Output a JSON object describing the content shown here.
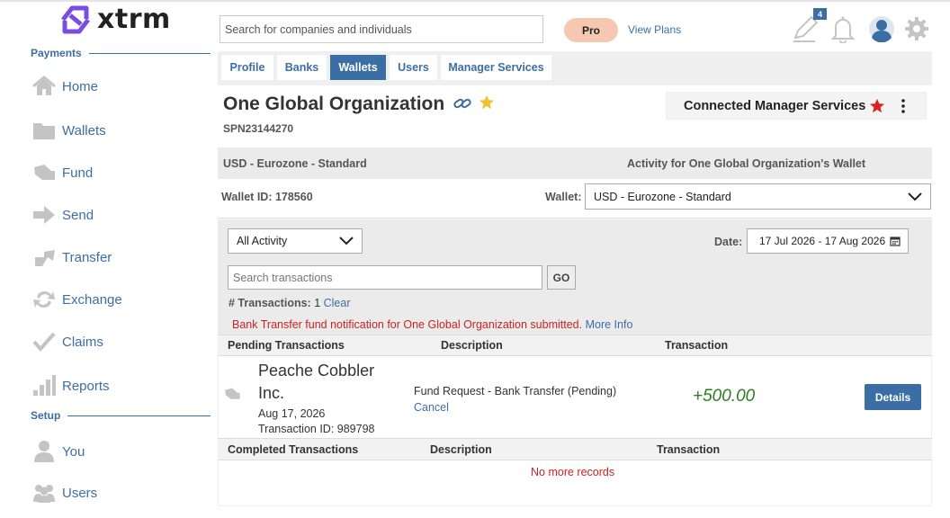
{
  "brand": {
    "name": "xtrm",
    "color": "#7b4ce0"
  },
  "sidebar": {
    "payments_label": "Payments",
    "setup_label": "Setup",
    "items": [
      {
        "label": "Home",
        "icon": "home-icon"
      },
      {
        "label": "Wallets",
        "icon": "folder-icon"
      },
      {
        "label": "Fund",
        "icon": "fund-icon"
      },
      {
        "label": "Send",
        "icon": "arrow-right-icon"
      },
      {
        "label": "Transfer",
        "icon": "transfer-icon"
      },
      {
        "label": "Exchange",
        "icon": "exchange-icon"
      },
      {
        "label": "Claims",
        "icon": "check-icon"
      },
      {
        "label": "Reports",
        "icon": "bar-chart-icon"
      },
      {
        "label": "You",
        "icon": "person-icon"
      },
      {
        "label": "Users",
        "icon": "users-icon"
      }
    ]
  },
  "header": {
    "search_placeholder": "Search for companies and individuals",
    "pro_label": "Pro",
    "view_plans": "View Plans",
    "notification_count": "4"
  },
  "tabs": [
    {
      "label": "Profile",
      "active": false
    },
    {
      "label": "Banks",
      "active": false
    },
    {
      "label": "Wallets",
      "active": true
    },
    {
      "label": "Users",
      "active": false
    },
    {
      "label": "Manager Services",
      "active": false
    }
  ],
  "org": {
    "name": "One Global Organization",
    "id": "SPN23144270",
    "connected_label": "Connected Manager Services"
  },
  "wallet": {
    "name": "USD - Eurozone - Standard",
    "activity_title": "Activity for One Global Organization's Wallet",
    "id_text": "Wallet ID: 178560",
    "select_label": "Wallet:",
    "selected": "USD - Eurozone - Standard"
  },
  "filters": {
    "activity_selected": "All Activity",
    "date_label": "Date:",
    "date_range": "17 Jul 2026 - 17 Aug 2026",
    "search_placeholder": "Search transactions",
    "go_label": "GO",
    "count_label": "# Transactions:",
    "count_value": "1",
    "clear_label": "Clear"
  },
  "notice": {
    "text": "Bank Transfer fund notification for One Global Organization submitted.",
    "link": "More Info"
  },
  "pending": {
    "headers": [
      "Pending Transactions",
      "Description",
      "Transaction"
    ],
    "row": {
      "company_line1": "Peache Cobbler",
      "company_line2": "Inc.",
      "date": "Aug 17, 2026",
      "transaction_id": "Transaction ID: 989798",
      "description": "Fund Request - Bank Transfer (Pending)",
      "cancel": "Cancel",
      "amount": "+500.00",
      "details": "Details"
    }
  },
  "completed": {
    "headers": [
      "Completed Transactions",
      "Description",
      "Transaction"
    ],
    "empty": "No more records"
  },
  "colors": {
    "accent": "#3c6ea6",
    "amount": "#2e7d1e",
    "notice": "#cc2222",
    "star_gold": "#f2c12e",
    "star_red": "#e02020"
  }
}
